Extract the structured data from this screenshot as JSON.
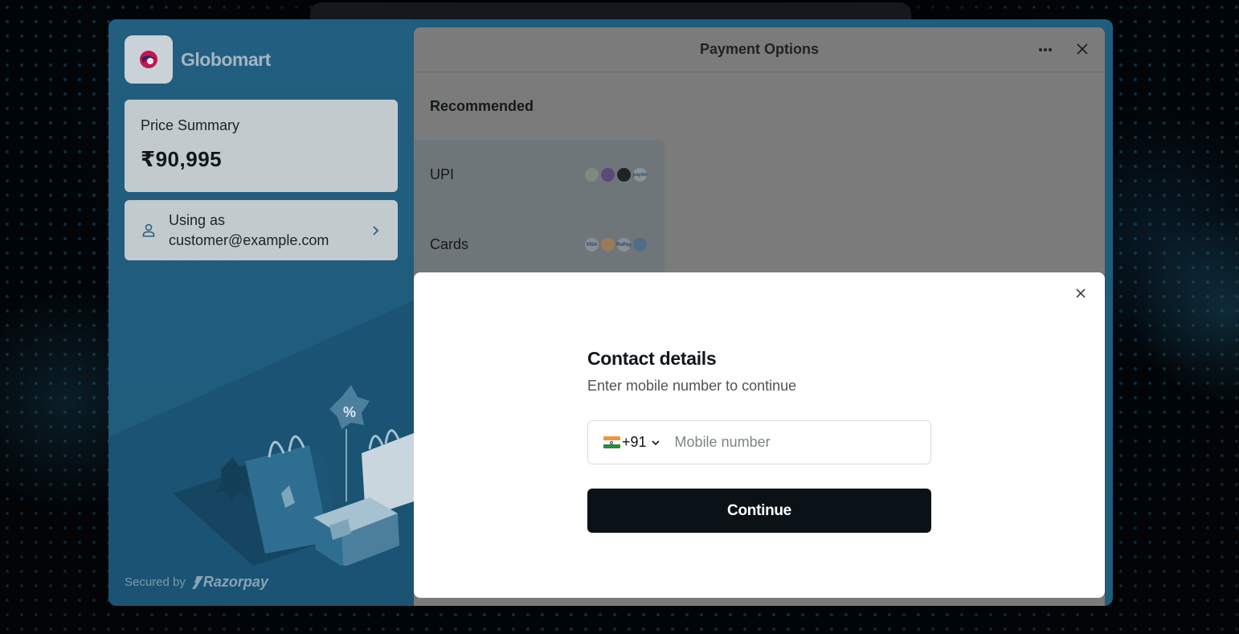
{
  "merchant": {
    "name": "Globomart"
  },
  "price_summary": {
    "title": "Price Summary",
    "amount": "₹90,995"
  },
  "user": {
    "label": "Using as",
    "email": "customer@example.com"
  },
  "footer": {
    "secured_by": "Secured by",
    "provider": "Razorpay"
  },
  "payment_options": {
    "title": "Payment Options",
    "recommended_label": "Recommended",
    "methods": [
      {
        "label": "UPI",
        "logos": [
          "gpay-icon",
          "phonepe-icon",
          "bhim-icon",
          "paytm-icon"
        ]
      },
      {
        "label": "Cards",
        "logos": [
          "visa-icon",
          "mastercard-icon",
          "rupay-icon",
          "diners-icon"
        ]
      }
    ]
  },
  "modal": {
    "title": "Contact details",
    "subtitle": "Enter mobile number to continue",
    "country_code": "+91",
    "phone_placeholder": "Mobile number",
    "phone_value": "",
    "continue_label": "Continue"
  },
  "colors": {
    "panel_blue": "#1f5c7d",
    "button_dark": "#0b1217",
    "overlay_gray": "#7b7b7b"
  }
}
